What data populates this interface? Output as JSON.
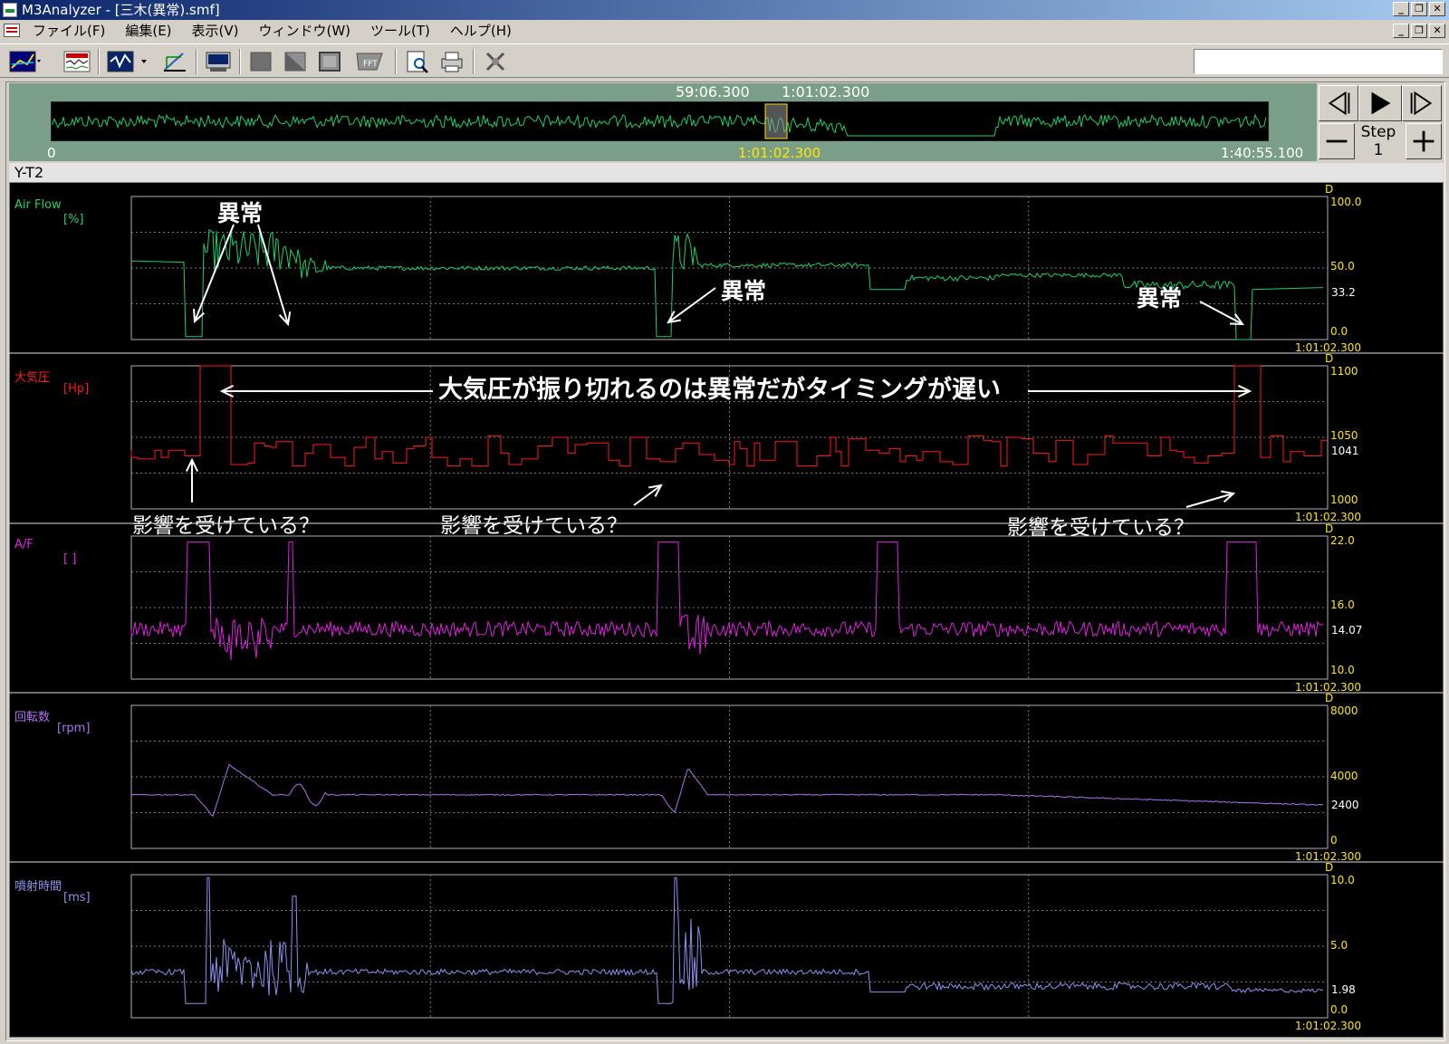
{
  "window": {
    "title": "M3Analyzer - [三木(異常).smf]"
  },
  "menu": {
    "items": [
      "ファイル(F)",
      "編集(E)",
      "表示(V)",
      "ウィンドウ(W)",
      "ツール(T)",
      "ヘルプ(H)"
    ]
  },
  "overview": {
    "window_start": "59:06.300",
    "window_end": "1:01:02.300",
    "range_start": "0",
    "cursor": "1:01:02.300",
    "range_end": "1:40:55.100"
  },
  "play_controls": {
    "step_label": "Step",
    "step_value": "1"
  },
  "graph_window": {
    "title": "Y-T2"
  },
  "colors": {
    "airflow": "#17d06a",
    "pressure": "#ff1a1a",
    "af": "#e020e0",
    "rpm": "#b070f0",
    "inj": "#9090f0",
    "tick": "#ffe600"
  },
  "channels": [
    {
      "label": "Air Flow",
      "unit": "[%]",
      "ticks": [
        "100.0",
        "50.0",
        "0.0"
      ],
      "cursor_value": "33.2",
      "timestamp": "1:01:02.300",
      "marker": "D"
    },
    {
      "label": "大気圧",
      "unit": "[Hp]",
      "ticks": [
        "1100",
        "1050",
        "1000"
      ],
      "cursor_value": "1041",
      "timestamp": "1:01:02.300",
      "marker": "D"
    },
    {
      "label": "A/F",
      "unit": "[ ]",
      "ticks": [
        "22.0",
        "16.0",
        "10.0"
      ],
      "cursor_value": "14.07",
      "timestamp": "1:01:02.300",
      "marker": "D"
    },
    {
      "label": "回転数",
      "unit": "[rpm]",
      "ticks": [
        "8000",
        "4000",
        "0"
      ],
      "cursor_value": "2400",
      "timestamp": "1:01:02.300",
      "marker": "D"
    },
    {
      "label": "噴射時間",
      "unit": "[ms]",
      "ticks": [
        "10.0",
        "5.0",
        "0.0"
      ],
      "cursor_value": "1.98",
      "timestamp": "1:01:02.300",
      "marker": "D"
    }
  ],
  "annotations": {
    "abnormal": "異常",
    "pressure_note": "大気圧が振り切れるのは異常だがタイミングが遅い",
    "influence": "影響を受けている？"
  }
}
